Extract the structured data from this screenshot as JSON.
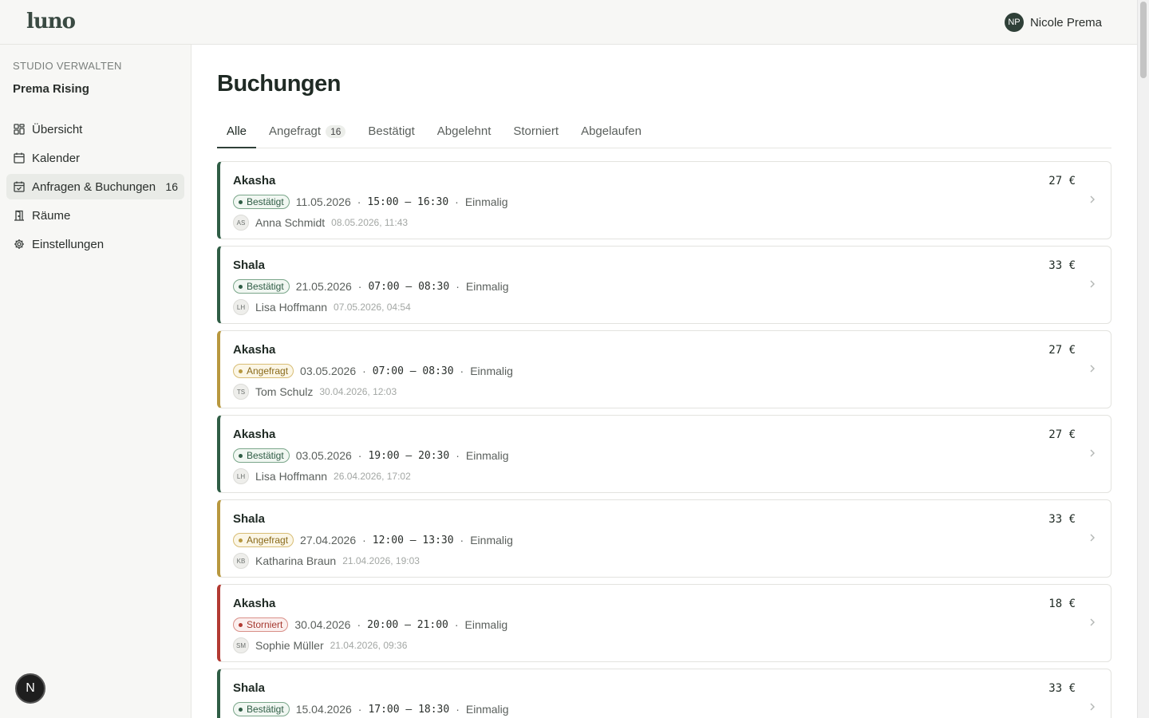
{
  "header": {
    "logo": "luno",
    "user_initials": "NP",
    "user_name": "Nicole Prema"
  },
  "sidebar": {
    "section_label": "STUDIO VERWALTEN",
    "studio_name": "Prema Rising",
    "items": [
      {
        "label": "Übersicht",
        "icon": "grid-icon"
      },
      {
        "label": "Kalender",
        "icon": "calendar-icon"
      },
      {
        "label": "Anfragen & Buchungen",
        "icon": "calendar-check-icon",
        "count": "16",
        "active": true
      },
      {
        "label": "Räume",
        "icon": "door-icon"
      },
      {
        "label": "Einstellungen",
        "icon": "gear-icon"
      }
    ],
    "help_initial": "N"
  },
  "main": {
    "title": "Buchungen",
    "tabs": [
      {
        "label": "Alle",
        "active": true
      },
      {
        "label": "Angefragt",
        "badge": "16"
      },
      {
        "label": "Bestätigt"
      },
      {
        "label": "Abgelehnt"
      },
      {
        "label": "Storniert"
      },
      {
        "label": "Abgelaufen"
      }
    ],
    "bookings": [
      {
        "room": "Akasha",
        "status": "Bestätigt",
        "status_type": "confirmed",
        "date": "11.05.2026",
        "time": "15:00 – 16:30",
        "type": "Einmalig",
        "initials": "AS",
        "user": "Anna Schmidt",
        "created": "08.05.2026, 11:43",
        "price": "27 €"
      },
      {
        "room": "Shala",
        "status": "Bestätigt",
        "status_type": "confirmed",
        "date": "21.05.2026",
        "time": "07:00 – 08:30",
        "type": "Einmalig",
        "initials": "LH",
        "user": "Lisa Hoffmann",
        "created": "07.05.2026, 04:54",
        "price": "33 €"
      },
      {
        "room": "Akasha",
        "status": "Angefragt",
        "status_type": "pending",
        "date": "03.05.2026",
        "time": "07:00 – 08:30",
        "type": "Einmalig",
        "initials": "TS",
        "user": "Tom Schulz",
        "created": "30.04.2026, 12:03",
        "price": "27 €"
      },
      {
        "room": "Akasha",
        "status": "Bestätigt",
        "status_type": "confirmed",
        "date": "03.05.2026",
        "time": "19:00 – 20:30",
        "type": "Einmalig",
        "initials": "LH",
        "user": "Lisa Hoffmann",
        "created": "26.04.2026, 17:02",
        "price": "27 €"
      },
      {
        "room": "Shala",
        "status": "Angefragt",
        "status_type": "pending",
        "date": "27.04.2026",
        "time": "12:00 – 13:30",
        "type": "Einmalig",
        "initials": "KB",
        "user": "Katharina Braun",
        "created": "21.04.2026, 19:03",
        "price": "33 €"
      },
      {
        "room": "Akasha",
        "status": "Storniert",
        "status_type": "cancelled",
        "date": "30.04.2026",
        "time": "20:00 – 21:00",
        "type": "Einmalig",
        "initials": "SM",
        "user": "Sophie Müller",
        "created": "21.04.2026, 09:36",
        "price": "18 €"
      },
      {
        "room": "Shala",
        "status": "Bestätigt",
        "status_type": "confirmed",
        "date": "15.04.2026",
        "time": "17:00 – 18:30",
        "type": "Einmalig",
        "initials": "",
        "user": "",
        "created": "",
        "price": "33 €"
      }
    ]
  },
  "colors": {
    "accent": "#2f4038",
    "confirmed": "#2f5d45",
    "pending": "#b8983f",
    "cancelled": "#b23a32"
  }
}
